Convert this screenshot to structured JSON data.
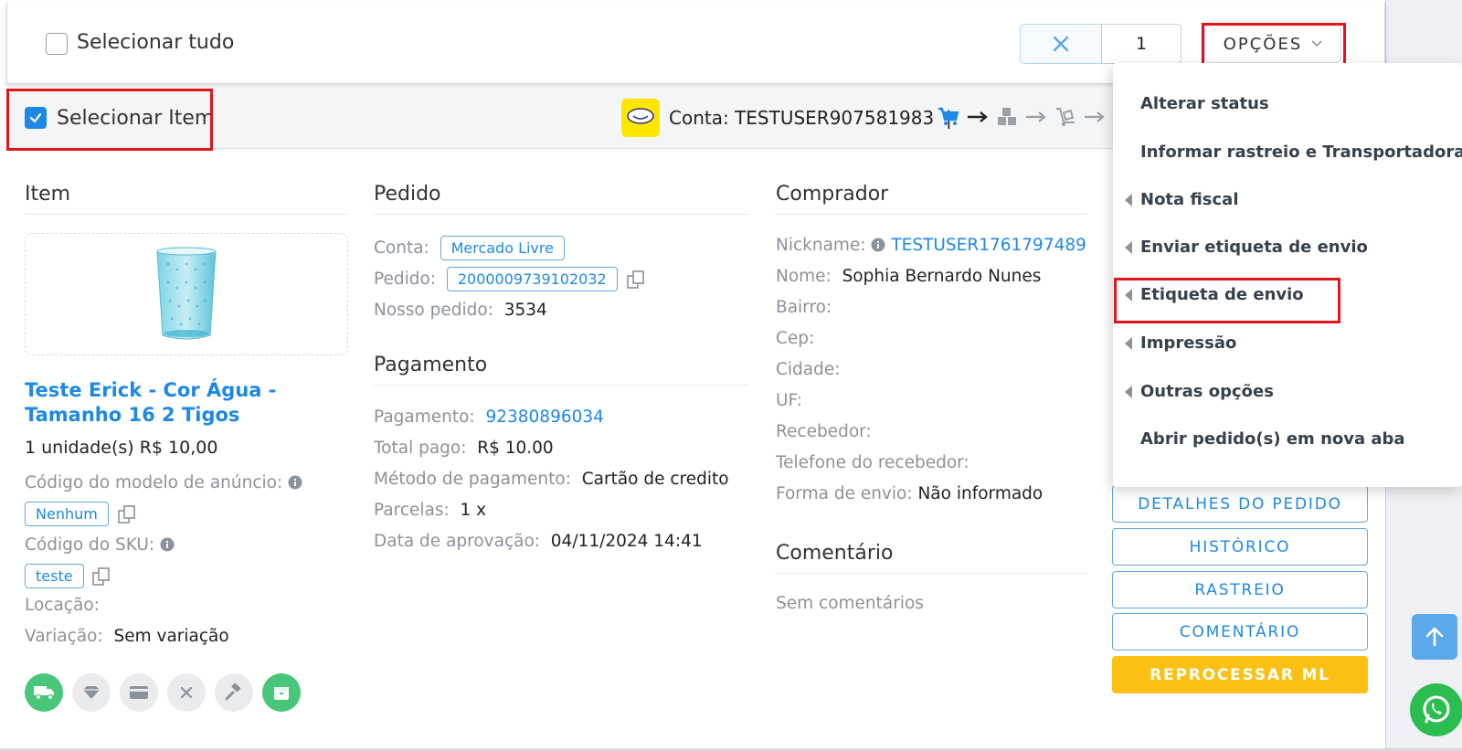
{
  "topbar": {
    "select_all_label": "Selecionar tudo",
    "clear_icon": "close-icon",
    "quantity": "1",
    "options_label": "OPÇÕES"
  },
  "item_header": {
    "select_item_label": "Selecionar Item",
    "conta_label": "Conta: TESTUSER907581983",
    "separator": "|",
    "flow_icons": [
      "cart-icon",
      "arrow-right-icon",
      "boxes-icon",
      "arrow-right-icon",
      "dolly-icon",
      "arrow-right-icon"
    ]
  },
  "item": {
    "section_title": "Item",
    "product_title": "Teste Erick - Cor Água - Tamanho 16 2 Tigos",
    "qty_price": "1 unidade(s) R$ 10,00",
    "modelo_label": "Código do modelo de anúncio:",
    "modelo_value": "Nenhum",
    "sku_label": "Código do SKU:",
    "sku_value": "teste",
    "locacao_label": "Locação:",
    "variacao_label": "Variação:",
    "variacao_value": "Sem variação",
    "action_icons": [
      "truck-icon",
      "diamond-icon",
      "credit-card-icon",
      "close-icon",
      "gavel-icon",
      "box-icon"
    ]
  },
  "pedido": {
    "section_title": "Pedido",
    "conta_label": "Conta:",
    "conta_value": "Mercado Livre",
    "pedido_label": "Pedido:",
    "pedido_value": "2000009739102032",
    "nosso_label": "Nosso pedido:",
    "nosso_value": "3534"
  },
  "pagamento": {
    "section_title": "Pagamento",
    "pagamento_label": "Pagamento:",
    "pagamento_value": "92380896034",
    "total_label": "Total pago:",
    "total_value": "R$ 10.00",
    "metodo_label": "Método de pagamento:",
    "metodo_value": "Cartão de credito",
    "parcelas_label": "Parcelas:",
    "parcelas_value": "1 x",
    "data_label": "Data de aprovação:",
    "data_value": "04/11/2024 14:41"
  },
  "comprador": {
    "section_title": "Comprador",
    "nickname_label": "Nickname:",
    "nickname_value": "TESTUSER1761797489",
    "nome_label": "Nome:",
    "nome_value": "Sophia Bernardo Nunes",
    "bairro_label": "Bairro:",
    "cep_label": "Cep:",
    "cidade_label": "Cidade:",
    "uf_label": "UF:",
    "recebedor_label": "Recebedor:",
    "telefone_label": "Telefone do recebedor:",
    "forma_label": "Forma de envio:",
    "forma_value": "Não informado"
  },
  "comentario": {
    "section_title": "Comentário",
    "text": "Sem comentários"
  },
  "right_buttons": {
    "detalhes": "DETALHES DO PEDIDO",
    "historico": "HISTÓRICO",
    "rastreio": "RASTREIO",
    "comentario": "COMENTÁRIO",
    "reprocessar": "REPROCESSAR ML"
  },
  "dropdown": {
    "items": [
      {
        "label": "Alterar status",
        "submenu": false
      },
      {
        "label": "Informar rastreio e Transportadora",
        "submenu": false
      },
      {
        "label": "Nota fiscal",
        "submenu": true
      },
      {
        "label": "Enviar etiqueta de envio",
        "submenu": true
      },
      {
        "label": "Etiqueta de envio",
        "submenu": true
      },
      {
        "label": "Impressão",
        "submenu": true
      },
      {
        "label": "Outras opções",
        "submenu": true
      },
      {
        "label": "Abrir pedido(s) em nova aba",
        "submenu": false
      }
    ]
  },
  "colors": {
    "accent": "#1e88e5",
    "highlight": "#e3141b",
    "reprocess": "#fac114",
    "success": "#48c77a"
  }
}
